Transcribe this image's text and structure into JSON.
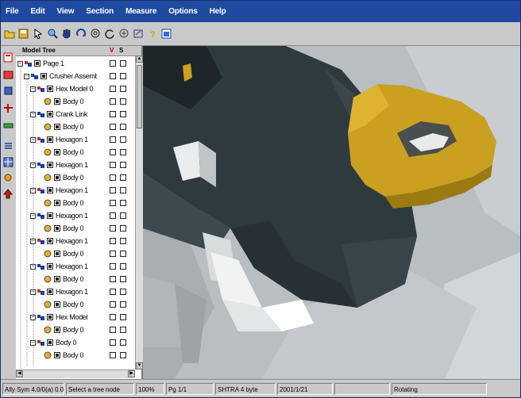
{
  "menu": [
    "File",
    "Edit",
    "View",
    "Section",
    "Measure",
    "Options",
    "Help"
  ],
  "toolbar_icons": [
    "open-folder-icon",
    "save-icon",
    "pointer-icon",
    "zoom-icon",
    "hand-icon",
    "rotate-icon",
    "target-icon",
    "orbit-icon",
    "reset-icon",
    "fit-icon",
    "help-icon",
    "window-icon"
  ],
  "tree": {
    "header": "Model Tree",
    "col1": "V",
    "col2": "S",
    "nodes": [
      {
        "label": "Page 1",
        "depth": 0
      },
      {
        "label": "Crusher Assembly",
        "depth": 1
      },
      {
        "label": "Hex Model 0",
        "depth": 2
      },
      {
        "label": "Body 0",
        "depth": 3
      },
      {
        "label": "Crank Link",
        "depth": 2
      },
      {
        "label": "Body 0",
        "depth": 3
      },
      {
        "label": "Hexagon 1",
        "depth": 2
      },
      {
        "label": "Body 0",
        "depth": 3
      },
      {
        "label": "Hexagon 1",
        "depth": 2
      },
      {
        "label": "Body 0",
        "depth": 3
      },
      {
        "label": "Hexagon 1",
        "depth": 2
      },
      {
        "label": "Body 0",
        "depth": 3
      },
      {
        "label": "Hexagon 1",
        "depth": 2
      },
      {
        "label": "Body 0",
        "depth": 3
      },
      {
        "label": "Hexagon 1",
        "depth": 2
      },
      {
        "label": "Body 0",
        "depth": 3
      },
      {
        "label": "Hexagon 1",
        "depth": 2
      },
      {
        "label": "Body 0",
        "depth": 3
      },
      {
        "label": "Hexagon 1",
        "depth": 2
      },
      {
        "label": "Body 0",
        "depth": 3
      },
      {
        "label": "Hex Model",
        "depth": 2
      },
      {
        "label": "Body 0",
        "depth": 3
      },
      {
        "label": "Body 0",
        "depth": 2
      },
      {
        "label": "Body 0",
        "depth": 3
      }
    ]
  },
  "status": {
    "f1": "Ally Sym 4.0/0(a) 0.0",
    "f2": "Select a tree node",
    "f3": "100%",
    "f4": "Pg 1/1",
    "f5": "SHTRA 4 byte",
    "f6": "2001/1/21",
    "f7": "Rotating"
  },
  "colors": {
    "menubar": "#1f4aa0",
    "gold_part": "#c9a020",
    "dark_part": "#2f3a3f"
  }
}
